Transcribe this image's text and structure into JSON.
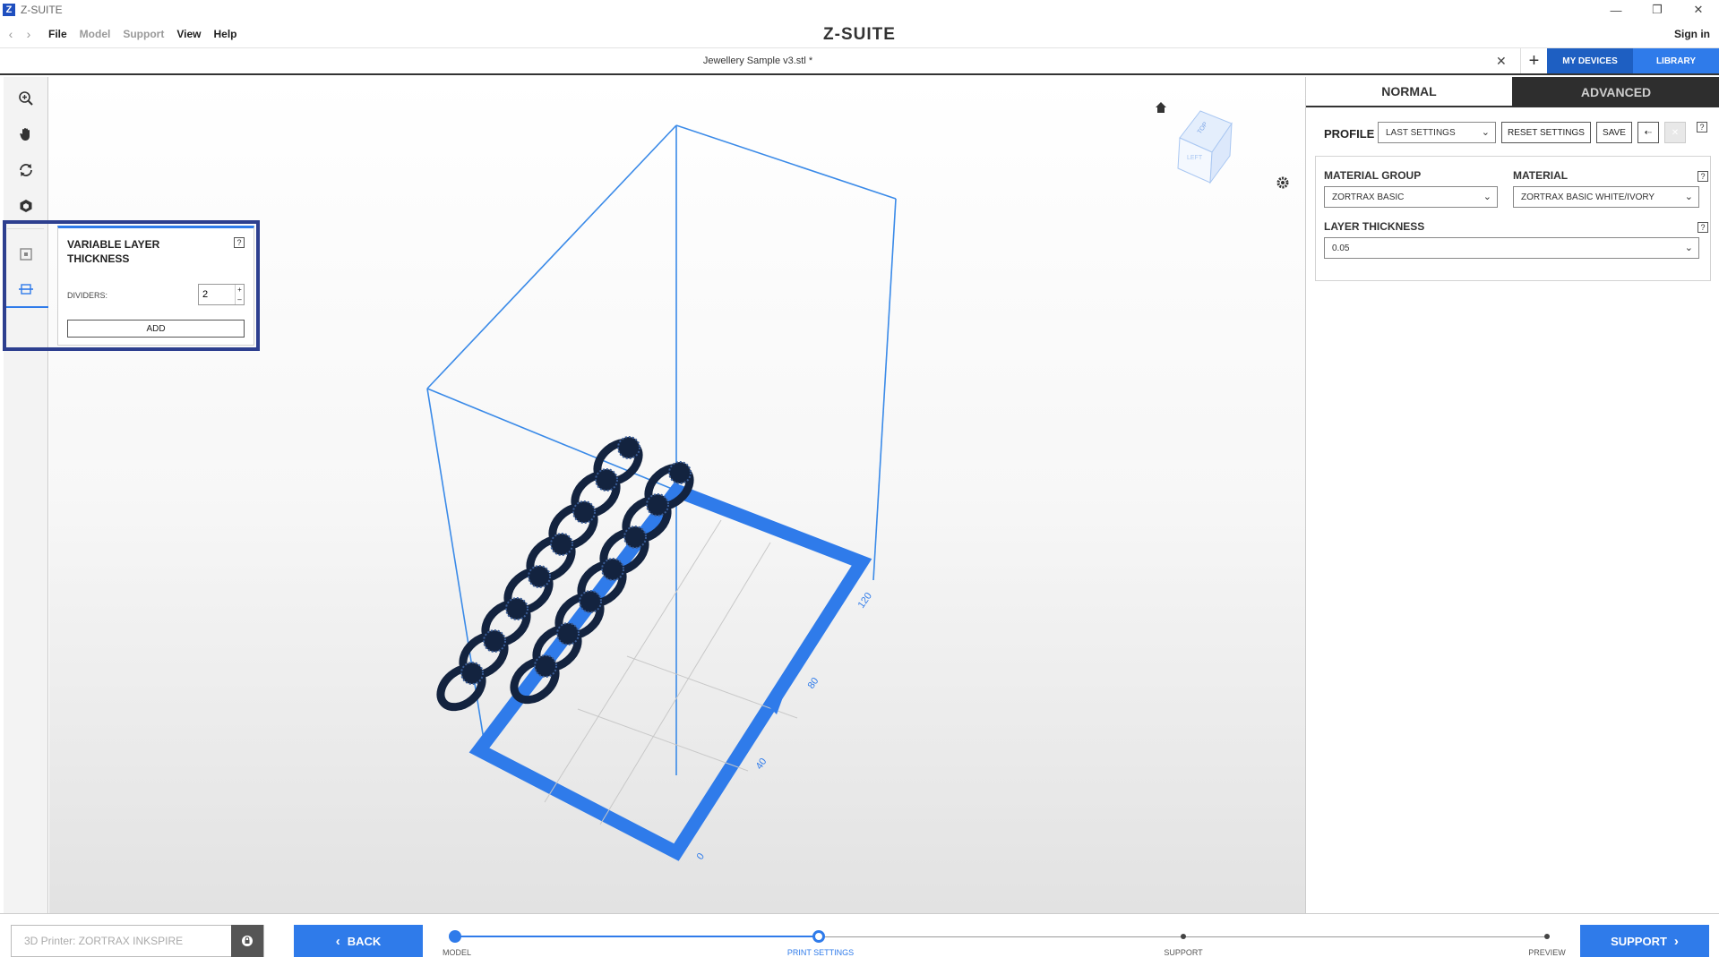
{
  "window": {
    "app_title": "Z-SUITE",
    "logo_letter": "Z",
    "controls": {
      "minimize": "—",
      "restore": "❐",
      "close": "✕"
    }
  },
  "menu": {
    "items": [
      {
        "label": "File",
        "enabled": true
      },
      {
        "label": "Model",
        "enabled": false
      },
      {
        "label": "Support",
        "enabled": false
      },
      {
        "label": "View",
        "enabled": true
      },
      {
        "label": "Help",
        "enabled": true
      }
    ],
    "brand": "Z-SUITE",
    "signin": "Sign in"
  },
  "tabs": {
    "file_name": "Jewellery Sample v3.stl *",
    "close_glyph": "✕",
    "add_glyph": "+",
    "my_devices": "MY DEVICES",
    "library": "LIBRARY"
  },
  "toolbar": {
    "tools": [
      "zoom-icon",
      "pan-hand-icon",
      "rotate-icon",
      "cube-view-icon",
      "object-select-icon",
      "layer-divider-icon"
    ]
  },
  "variable_layer": {
    "title": "VARIABLE LAYER THICKNESS",
    "help": "?",
    "dividers_label": "DIVIDERS:",
    "dividers_value": "2",
    "add_label": "ADD"
  },
  "viewport": {
    "axis_labels": [
      "0",
      "40",
      "80",
      "120"
    ],
    "cube_top": "TOP",
    "cube_left": "LEFT",
    "accent": "#2f7bea",
    "model_color": "#13233f"
  },
  "settings": {
    "tab_normal": "NORMAL",
    "tab_advanced": "ADVANCED",
    "profile_label": "PROFILE",
    "profile_value": "LAST SETTINGS",
    "reset_label": "RESET SETTINGS",
    "save_label": "SAVE",
    "material_group_label": "MATERIAL GROUP",
    "material_group_value": "ZORTRAX BASIC",
    "material_label": "MATERIAL",
    "material_value": "ZORTRAX BASIC WHITE/IVORY",
    "layer_label": "LAYER THICKNESS",
    "layer_value": "0.05",
    "help": "?"
  },
  "bottom": {
    "printer_placeholder": "3D Printer: ZORTRAX INKSPIRE",
    "back_label": "BACK",
    "support_label": "SUPPORT",
    "steps": [
      {
        "label": "MODEL",
        "state": "done"
      },
      {
        "label": "PRINT SETTINGS",
        "state": "current"
      },
      {
        "label": "SUPPORT",
        "state": "todo"
      },
      {
        "label": "PREVIEW",
        "state": "todo"
      }
    ]
  }
}
